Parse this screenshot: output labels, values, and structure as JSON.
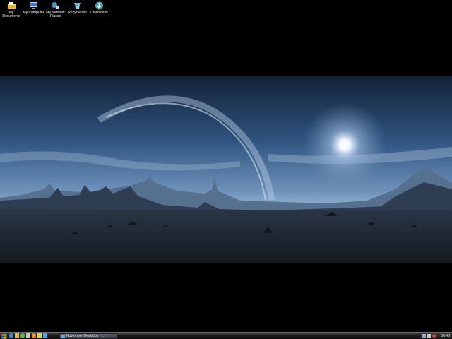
{
  "desktop_icons": [
    {
      "label": "My Documents",
      "icon": "my-documents-icon"
    },
    {
      "label": "My Computer",
      "icon": "my-computer-icon"
    },
    {
      "label": "My Network Places",
      "icon": "my-network-places-icon"
    },
    {
      "label": "Recycle Bin",
      "icon": "recycle-bin-icon"
    },
    {
      "label": "Downloads",
      "icon": "downloads-icon"
    }
  ],
  "taskbar": {
    "start_icon": "windows-logo-icon",
    "quick_launch": [
      "ie-icon",
      "folder-icon",
      "media-icon",
      "app-icon",
      "app-icon",
      "app-icon",
      "app-icon"
    ],
    "task_title": "November Desktops - ...",
    "clock": "06:48"
  },
  "colors": {
    "taskbar": "#1c1c1c",
    "wallpaper_sky": "#3f6b9a",
    "wallpaper_ground": "#1e2632"
  }
}
